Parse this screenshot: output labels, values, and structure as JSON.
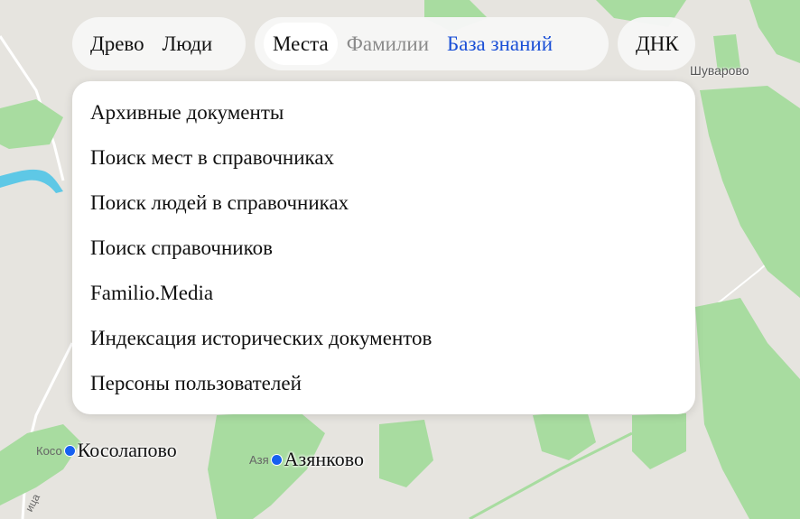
{
  "nav": {
    "group1": [
      "Древо",
      "Люди"
    ],
    "group2": [
      "Места",
      "Фамилии",
      "База знаний"
    ],
    "group3": [
      "ДНК"
    ],
    "active": "Места"
  },
  "dropdown": {
    "items": [
      "Архивные документы",
      "Поиск мест в справочниках",
      "Поиск людей в справочниках",
      "Поиск справочников",
      "Familio.Media",
      "Индексация исторических документов",
      "Персоны пользователей"
    ]
  },
  "map": {
    "places": [
      {
        "small": "Косо",
        "name": "Косолапово"
      },
      {
        "small": "Азя",
        "name": "Азянково"
      }
    ],
    "village_label": "Шуварово",
    "road_label": "ица",
    "colors": {
      "background": "#e6e4df",
      "forest": "#a8dca0",
      "water": "#5ec8e6",
      "marker": "#1660f0",
      "link": "#1a4fd6"
    }
  }
}
